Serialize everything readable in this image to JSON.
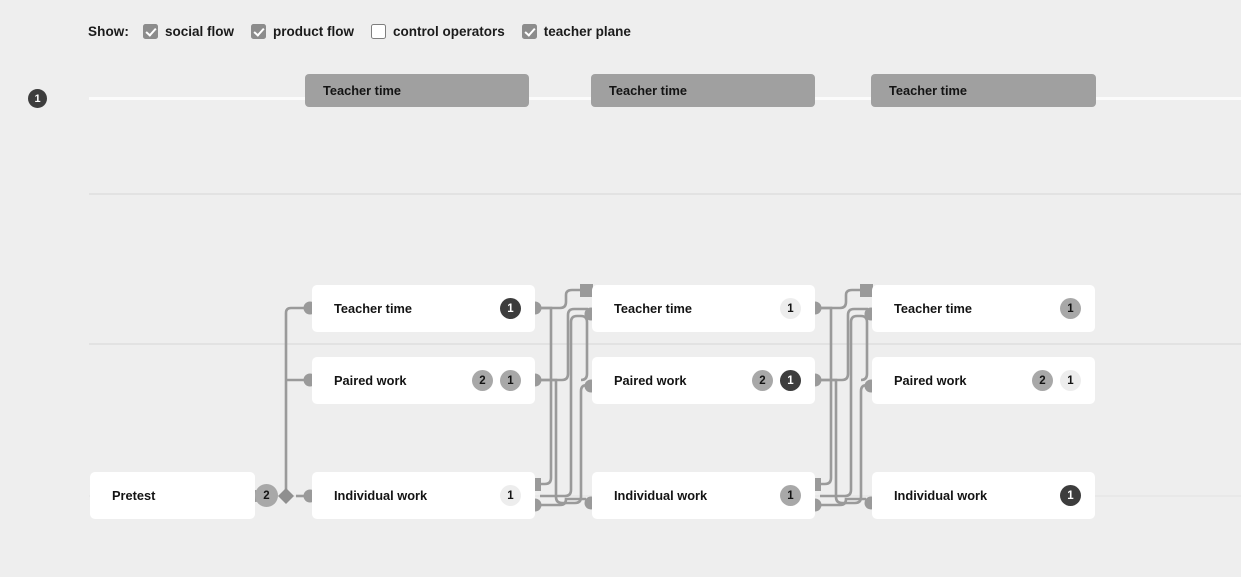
{
  "toolbar": {
    "label": "Show:",
    "options": [
      {
        "name": "social-flow",
        "label": "social flow",
        "checked": true
      },
      {
        "name": "product-flow",
        "label": "product flow",
        "checked": true
      },
      {
        "name": "control-operators",
        "label": "control operators",
        "checked": false
      },
      {
        "name": "teacher-plane",
        "label": "teacher plane",
        "checked": true
      }
    ]
  },
  "teacher_plane": {
    "badge": "1",
    "bars": [
      {
        "label": "Teacher time"
      },
      {
        "label": "Teacher time"
      },
      {
        "label": "Teacher time"
      }
    ]
  },
  "flow": {
    "start_card": {
      "label": "Pretest",
      "badges": [
        {
          "value": "2",
          "shade": "mid"
        }
      ]
    },
    "columns": [
      {
        "rows": [
          {
            "label": "Teacher time",
            "badges": [
              {
                "value": "1",
                "shade": "dark"
              }
            ]
          },
          {
            "label": "Paired work",
            "badges": [
              {
                "value": "2",
                "shade": "mid"
              },
              {
                "value": "1",
                "shade": "mid"
              }
            ]
          },
          {
            "label": "Individual work",
            "badges": [
              {
                "value": "1",
                "shade": "light"
              }
            ]
          }
        ]
      },
      {
        "rows": [
          {
            "label": "Teacher time",
            "badges": [
              {
                "value": "1",
                "shade": "light"
              }
            ]
          },
          {
            "label": "Paired work",
            "badges": [
              {
                "value": "2",
                "shade": "mid"
              },
              {
                "value": "1",
                "shade": "dark"
              }
            ]
          },
          {
            "label": "Individual work",
            "badges": [
              {
                "value": "1",
                "shade": "mid"
              }
            ]
          }
        ]
      },
      {
        "rows": [
          {
            "label": "Teacher time",
            "badges": [
              {
                "value": "1",
                "shade": "mid"
              }
            ]
          },
          {
            "label": "Paired work",
            "badges": [
              {
                "value": "2",
                "shade": "mid"
              },
              {
                "value": "1",
                "shade": "light"
              }
            ]
          },
          {
            "label": "Individual work",
            "badges": [
              {
                "value": "1",
                "shade": "dark"
              }
            ]
          }
        ]
      }
    ]
  },
  "colors": {
    "background": "#eeeeee",
    "card": "#ffffff",
    "bar": "#a0a0a0",
    "edge": "#9a9a9a",
    "badge_dark": "#3d3d3d",
    "badge_mid": "#a8a8a8",
    "badge_light": "#ededed",
    "separator": "#e2e2e2"
  }
}
